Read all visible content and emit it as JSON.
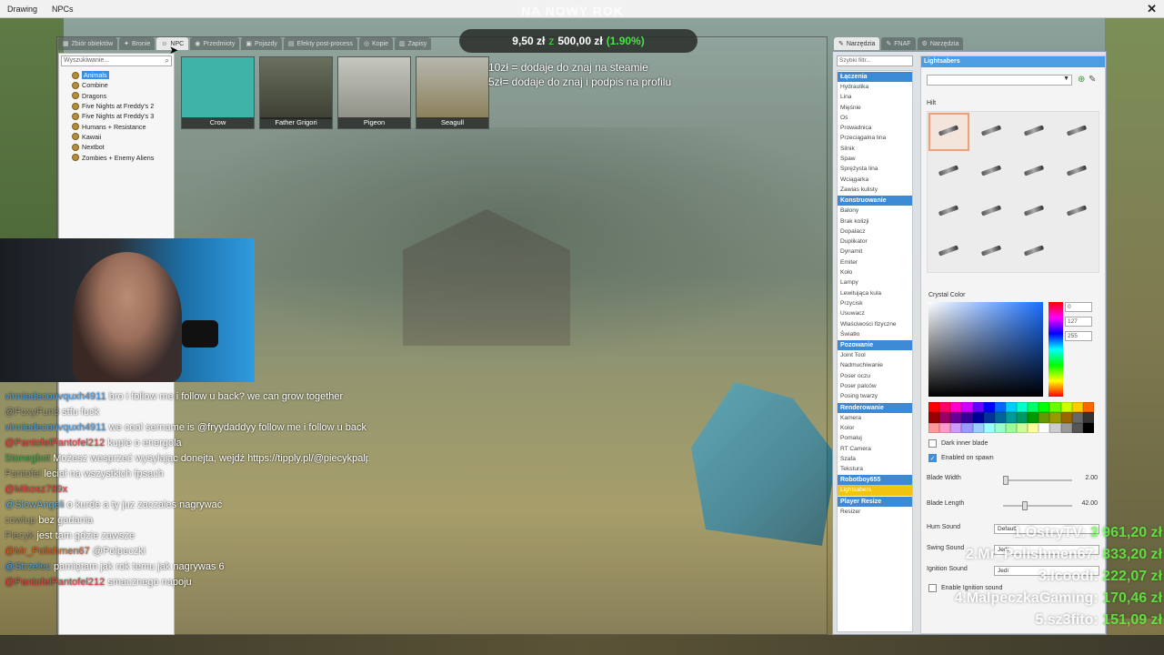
{
  "menubar": {
    "items": [
      "Drawing",
      "NPCs"
    ],
    "overlay_title": "NA NOWY ROK",
    "close_glyph": "✕"
  },
  "donation": {
    "current": "9,50 zł",
    "sep": "z",
    "goal": "500,00 zł",
    "percent": "(1.90%)",
    "info": [
      "10zł = dodaje do znaj na steamie",
      "5zł= dodaje do znaj i podpis na profilu"
    ]
  },
  "spawn_tabs": [
    "Zbiór obiektów",
    "Bronie",
    "NPC",
    "Przedmioty",
    "Pojazdy",
    "Efekty post-process",
    "Kopie",
    "Zapisy"
  ],
  "npc_search": {
    "placeholder": "Wyszukiwanie..."
  },
  "npc_categories": [
    "Animals",
    "Combine",
    "Dragons",
    "Five Nights at Freddy's 2",
    "Five Nights at Freddy's 3",
    "Humans + Resistance",
    "Kawaii",
    "Nextbot",
    "Zombies + Enemy Aliens"
  ],
  "npc_cards": [
    "Crow",
    "Father Grigori",
    "Pigeon",
    "Seagull"
  ],
  "chat": [
    {
      "user": "vinniedeconvquxh4911",
      "text": "bro i follow me i follow u back? we can grow together",
      "cls": "u1"
    },
    {
      "user": "@FoxyFun3",
      "text": "stfu fuck",
      "cls": "dim"
    },
    {
      "user": "vinniedeconvquxh4911",
      "text": "we cool sername is @fryydaddyy follow me i follow u back",
      "cls": "u1"
    },
    {
      "user": "@PantofelPantofel212",
      "text": "kupie o energola",
      "cls": "u2"
    },
    {
      "user": "Stonegbot",
      "text": "Możesz wesprzeć wysyłając donejta, wejdź https://tipply.pl/@piecykpalpeczki",
      "cls": "u4"
    },
    {
      "user": "Pantofel",
      "text": "leciał na wszystkich fpsach",
      "cls": "dim"
    },
    {
      "user": "@Mikosz789x",
      "text": "",
      "cls": "u2"
    },
    {
      "user": "@SlowAngeli",
      "text": "o kurde a ty juz zaczales nagrywać",
      "cls": "u5"
    },
    {
      "user": "cowlup",
      "text": "bez gadania",
      "cls": "dim"
    },
    {
      "user": "Piecyk",
      "text": "jest tam gdzie zawsze",
      "cls": "dim"
    },
    {
      "user": "@Mr_Polishmen67",
      "text": "@Polpeczki",
      "cls": "u3"
    },
    {
      "user": "@Strzelec",
      "text": "pamiętam jak rok temu jak nagrywas 6",
      "cls": "u1"
    },
    {
      "user": "@PantofelPantofel212",
      "text": "smacznego napoju",
      "cls": "u2"
    }
  ],
  "tool_tabs": [
    "Narzędzia",
    "FNAF",
    "Narzędzia"
  ],
  "tool_search": {
    "placeholder": "Szybki filtr..."
  },
  "tool_groups": [
    {
      "name": "Łączenia",
      "items": [
        "Hydraulika",
        "Lina",
        "Mięśnie",
        "Oś",
        "Prowadnica",
        "Przeciągalna lina",
        "Silnik",
        "Spaw",
        "Sprężysta lina",
        "Wciągarka",
        "Zawias kulisty"
      ]
    },
    {
      "name": "Konstruowanie",
      "items": [
        "Balony",
        "Brak kolizji",
        "Dopalacz",
        "Duplikator",
        "Dynamit",
        "Emiter",
        "Koło",
        "Lampy",
        "Lewitująca kula",
        "Przycisk",
        "Usuwacz",
        "Właściwości fizyczne",
        "Światło"
      ]
    },
    {
      "name": "Pozowanie",
      "items": [
        "Joint Tool",
        "Nadmuchiwanie",
        "Poser oczu",
        "Poser palców",
        "Posing twarzy"
      ]
    },
    {
      "name": "Renderowanie",
      "items": [
        "Kamera",
        "Kolor",
        "Pomaluj",
        "RT Camera",
        "Szafa",
        "Tekstura"
      ]
    },
    {
      "name": "Robotboy655",
      "items": [
        "Lightsabers"
      ]
    },
    {
      "name": "Player Resize",
      "items": [
        "Resizer"
      ]
    }
  ],
  "sabers": {
    "title": "Lightsabers",
    "hilt_label": "Hilt",
    "crystal_label": "Crystal Color",
    "rgb": [
      "0",
      "127",
      "255"
    ],
    "dark_inner": "Dark inner blade",
    "enabled_spawn": "Enabled on spawn",
    "blade_width_label": "Blade Width",
    "blade_width": "2.00",
    "blade_width_frac": 0.0,
    "blade_length_label": "Blade Length",
    "blade_length": "42.00",
    "blade_length_frac": 0.3,
    "hum_label": "Hum Sound",
    "hum_value": "Default",
    "swing_label": "Swing Sound",
    "swing_value": "Jedi",
    "ignition_label": "Ignition Sound",
    "ignition_value": "Jedi",
    "enable_label": "Enable Ignition sound"
  },
  "palette_colors": [
    "#ff0000",
    "#ff0066",
    "#ff00cc",
    "#cc00ff",
    "#6600ff",
    "#0000ff",
    "#0066ff",
    "#00ccff",
    "#00ffcc",
    "#00ff66",
    "#00ff00",
    "#66ff00",
    "#ccff00",
    "#ffcc00",
    "#ff6600",
    "#990000",
    "#990066",
    "#660099",
    "#330099",
    "#000099",
    "#003399",
    "#006699",
    "#009999",
    "#009966",
    "#009900",
    "#669900",
    "#999900",
    "#996600",
    "#666666",
    "#333333",
    "#ff9999",
    "#ff99cc",
    "#cc99ff",
    "#9999ff",
    "#99ccff",
    "#99ffff",
    "#99ffcc",
    "#99ff99",
    "#ccff99",
    "#ffff99",
    "#ffffff",
    "#cccccc",
    "#999999",
    "#555555",
    "#000000"
  ],
  "leaderboard": [
    {
      "rank": "1.OstryTV:",
      "amount": "3 961,20 zł"
    },
    {
      "rank": "2.Mr_Polishmen67:",
      "amount": "833,20 zł"
    },
    {
      "rank": "3.Icoodi:",
      "amount": "222,07 zł"
    },
    {
      "rank": "4.MalpeczkaGaming:",
      "amount": "170,46 zł"
    },
    {
      "rank": "5.sz3fito:",
      "amount": "151,09 zł"
    }
  ]
}
